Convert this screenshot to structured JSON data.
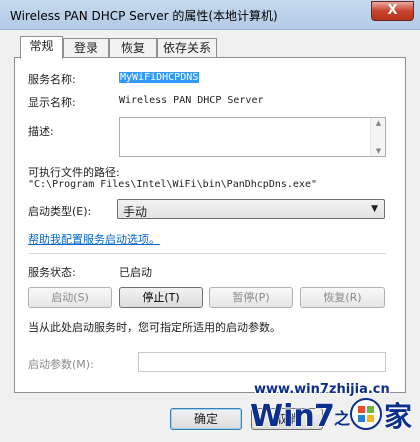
{
  "window": {
    "title": "Wireless PAN DHCP Server 的属性(本地计算机)",
    "close_glyph": "X"
  },
  "tabs": [
    {
      "label": "常规",
      "active": true
    },
    {
      "label": "登录",
      "active": false
    },
    {
      "label": "恢复",
      "active": false
    },
    {
      "label": "依存关系",
      "active": false
    }
  ],
  "general": {
    "service_name_label": "服务名称:",
    "service_name_value": "MyWiFiDHCPDNS",
    "display_name_label": "显示名称:",
    "display_name_value": "Wireless PAN DHCP Server",
    "description_label": "描述:",
    "description_value": "",
    "path_label": "可执行文件的路径:",
    "path_value": "\"C:\\Program Files\\Intel\\WiFi\\bin\\PanDhcpDns.exe\"",
    "startup_type_label": "启动类型(E):",
    "startup_type_value": "手动",
    "help_link": "帮助我配置服务启动选项。",
    "status_label": "服务状态:",
    "status_value": "已启动",
    "buttons": {
      "start": "启动(S)",
      "stop": "停止(T)",
      "pause": "暂停(P)",
      "resume": "恢复(R)"
    },
    "hint": "当从此处启动服务时，您可指定所适用的启动参数。",
    "params_label": "启动参数(M):",
    "params_value": ""
  },
  "dialog_buttons": {
    "ok": "确定",
    "cancel": "取消"
  },
  "watermark": {
    "url": "www.win7zhijia.cn",
    "logo_text": "Win7之家"
  },
  "colors": {
    "accent_link": "#0066cc",
    "selection": "#3399ff",
    "close_button": "#c7452f"
  }
}
